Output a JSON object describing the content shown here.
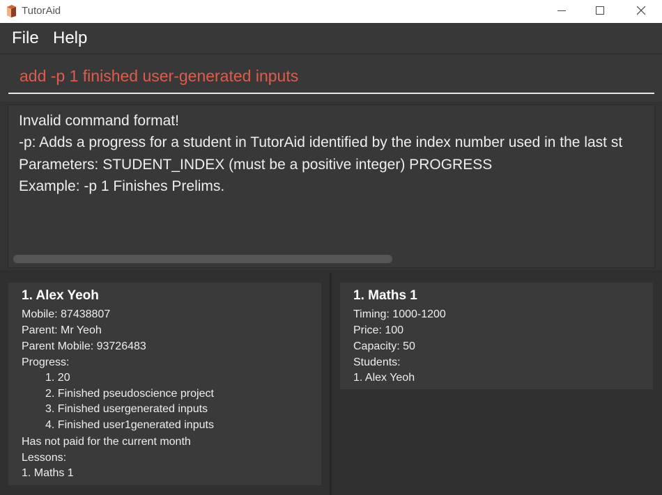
{
  "window": {
    "title": "TutorAid"
  },
  "menu": {
    "file": "File",
    "help": "Help"
  },
  "command": {
    "value": "add -p 1 finished user-generated inputs"
  },
  "result": {
    "lines": [
      "Invalid command format!",
      "-p: Adds a progress for a student in TutorAid identified by the index number used in the last st",
      "Parameters: STUDENT_INDEX (must be a positive integer) PROGRESS",
      "Example: -p 1 Finishes Prelims."
    ]
  },
  "student": {
    "title": "1.  Alex Yeoh",
    "mobile": "Mobile: 87438807",
    "parent": "Parent: Mr Yeoh",
    "parent_mobile": "Parent Mobile: 93726483",
    "progress_label": "Progress:",
    "progress": [
      "1. 20",
      "2. Finished pseudoscience project",
      "3. Finished usergenerated inputs",
      "4. Finished user1generated inputs"
    ],
    "payment": "Has not paid for the current month",
    "lessons_label": "Lessons:",
    "lessons": [
      "1.  Maths 1"
    ]
  },
  "lesson": {
    "title": "1.  Maths 1",
    "timing": "Timing: 1000-1200",
    "price": "Price: 100",
    "capacity": "Capacity: 50",
    "students_label": "Students:",
    "students": [
      "1.  Alex Yeoh"
    ]
  }
}
